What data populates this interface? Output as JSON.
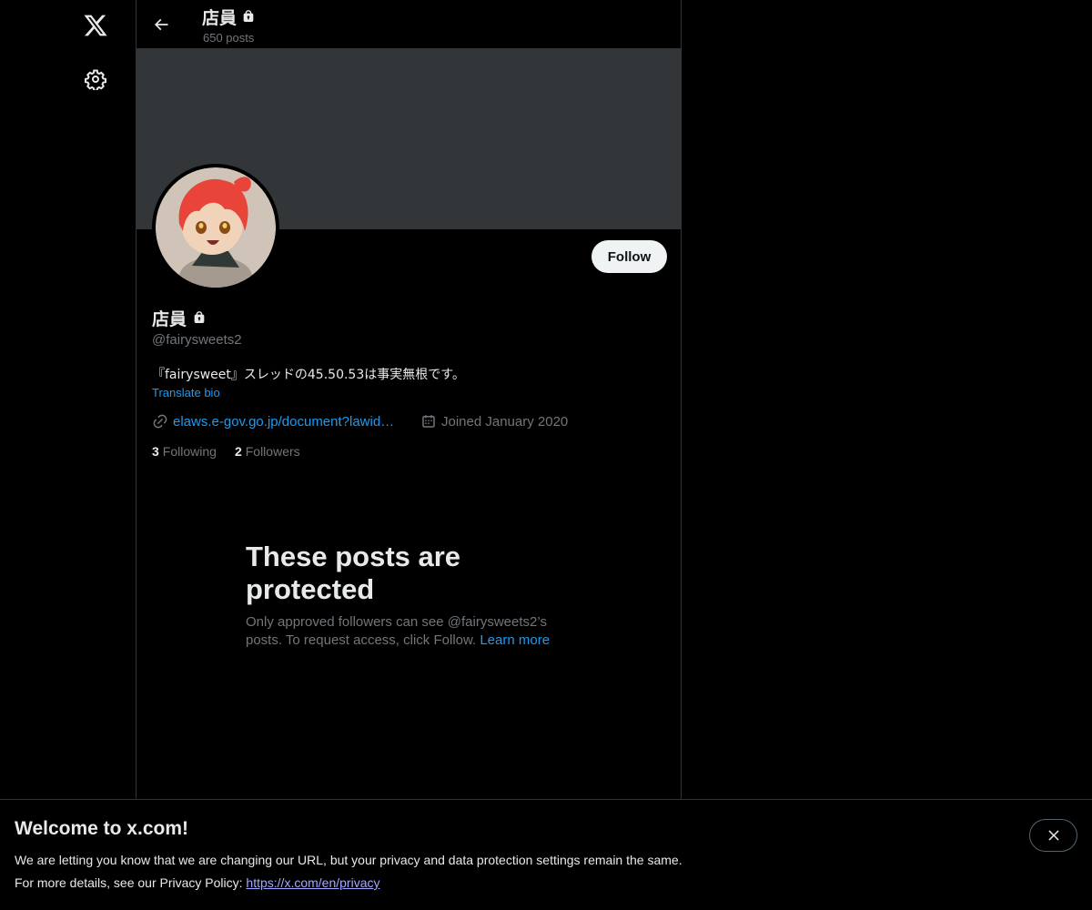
{
  "nav": {
    "logo_icon": "x-logo-icon",
    "settings_icon": "gear-icon"
  },
  "header": {
    "title": "店員",
    "posts_count": "650 posts"
  },
  "profile": {
    "name": "店員",
    "handle": "@fairysweets2",
    "bio": "『fairysweet』スレッドの45.50.53は事実無根です。",
    "translate_label": "Translate bio",
    "link": "elaws.e-gov.go.jp/document?lawid…",
    "joined": "Joined January 2020",
    "following_count": "3",
    "following_label": "Following",
    "followers_count": "2",
    "followers_label": "Followers",
    "follow_button": "Follow",
    "protected": true
  },
  "protected_notice": {
    "title": "These posts are protected",
    "body": "Only approved followers can see @fairysweets2’s posts. To request access, click Follow.",
    "learn_more": "Learn more"
  },
  "welcome": {
    "title": "Welcome to x.com!",
    "line1": "We are letting you know that we are changing our URL, but your privacy and data protection settings remain the same.",
    "line2_prefix": "For more details, see our Privacy Policy:",
    "privacy_link": "https://x.com/en/privacy"
  },
  "colors": {
    "background": "#000000",
    "banner": "#333639",
    "accent": "#1d9bf0",
    "muted_text": "#71767b",
    "primary_text": "#e7e9ea"
  }
}
